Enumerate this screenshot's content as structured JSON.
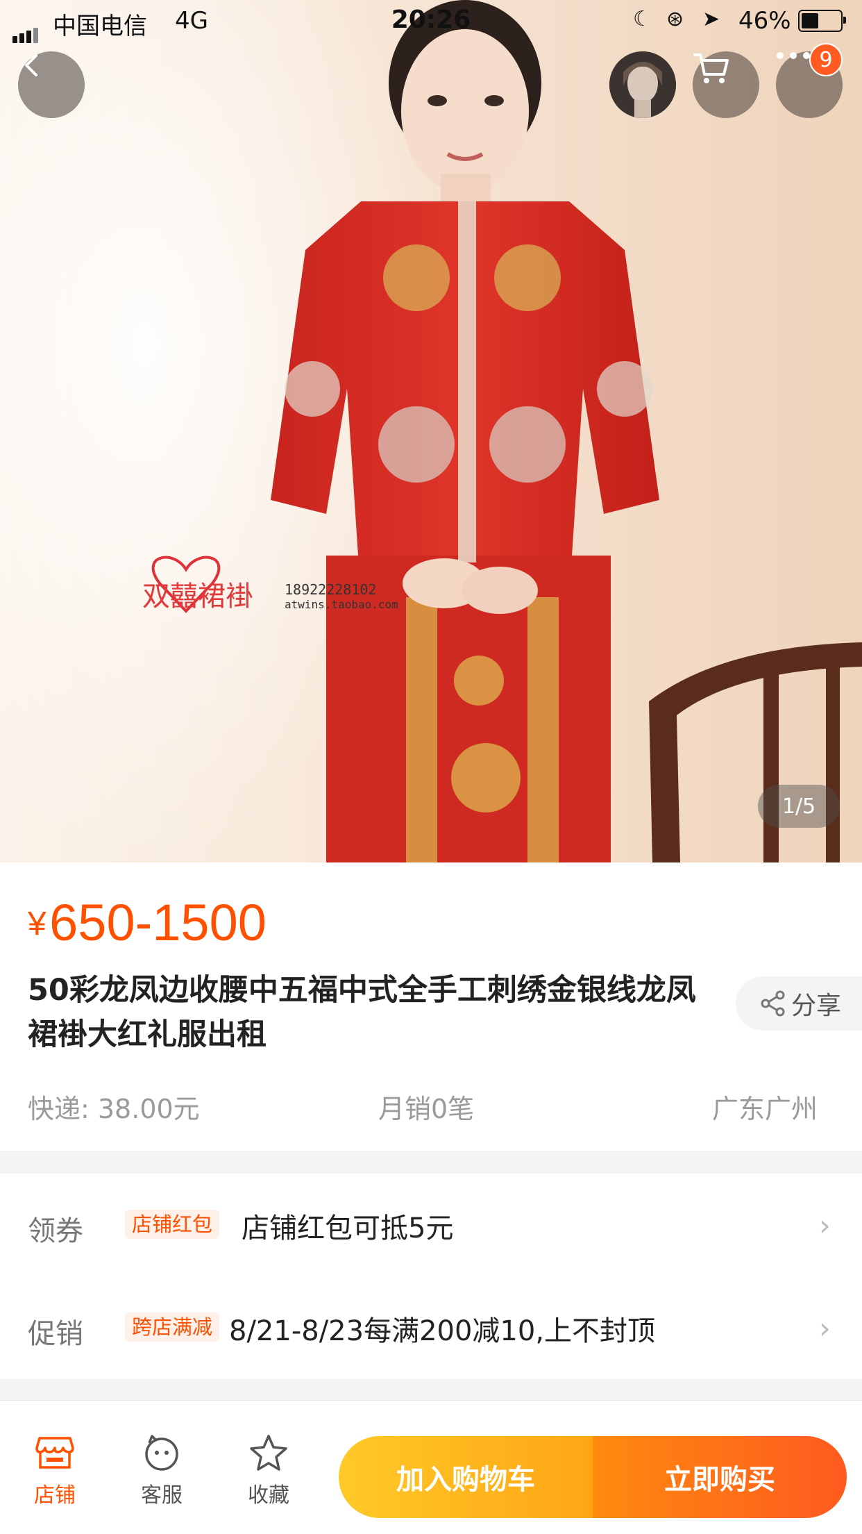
{
  "status_bar": {
    "carrier": "中国电信",
    "network": "4G",
    "time": "20:26",
    "battery_pct": "46%",
    "battery_level": 0.46
  },
  "gallery": {
    "counter": "1/5",
    "watermark_text": "双囍裙褂",
    "watermark_phone": "18922228102",
    "watermark_url": "atwins.taobao.com"
  },
  "header": {
    "more_badge": "9",
    "icons": [
      "back-icon",
      "avatar",
      "cart-icon",
      "more-icon"
    ]
  },
  "product": {
    "currency": "¥",
    "price": "650-1500",
    "title": "50彩龙凤边收腰中五福中式全手工刺绣金银线龙凤裙褂大红礼服出租",
    "share_label": "分享",
    "shipping": "快递: 38.00元",
    "sales": "月销0笔",
    "location": "广东广州"
  },
  "promotions": [
    {
      "label": "领券",
      "tag": "店铺红包",
      "text": "店铺红包可抵5元"
    },
    {
      "label": "促销",
      "tag": "跨店满减",
      "text": "8/21-8/23每满200减10,上不封顶"
    }
  ],
  "bottom_bar": {
    "tabs": [
      {
        "label": "店铺",
        "icon": "store-icon"
      },
      {
        "label": "客服",
        "icon": "customer-service-icon"
      },
      {
        "label": "收藏",
        "icon": "star-icon"
      }
    ],
    "add_to_cart": "加入购物车",
    "buy_now": "立即购买"
  },
  "colors": {
    "accent": "#ff5000",
    "cart_button": "#ffb41e",
    "buy_button": "#ff6a16"
  }
}
